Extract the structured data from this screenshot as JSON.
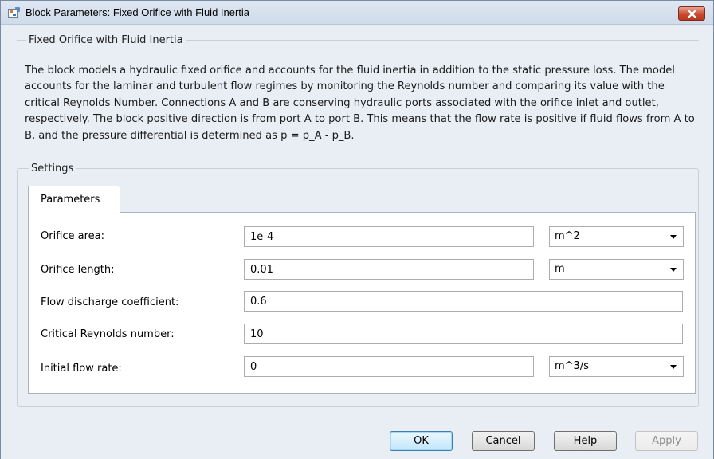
{
  "window": {
    "title": "Block Parameters: Fixed Orifice with Fluid Inertia"
  },
  "block": {
    "group_title": "Fixed Orifice with Fluid Inertia",
    "description": "The block models a hydraulic fixed orifice and accounts for the fluid inertia in addition to the static pressure loss. The model accounts for the laminar and turbulent flow regimes by monitoring the Reynolds number and comparing its value with the critical Reynolds Number. Connections A and B are conserving hydraulic ports associated with the orifice inlet and outlet, respectively. The block positive direction is from port A to port B. This means that the flow rate is positive if fluid flows from A to B, and the pressure differential is determined as p = p_A - p_B."
  },
  "settings": {
    "label": "Settings",
    "tab_label": "Parameters",
    "params": [
      {
        "label": "Orifice area:",
        "value": "1e-4",
        "unit": "m^2"
      },
      {
        "label": "Orifice length:",
        "value": "0.01",
        "unit": "m"
      },
      {
        "label": "Flow discharge coefficient:",
        "value": "0.6"
      },
      {
        "label": "Critical Reynolds number:",
        "value": "10"
      },
      {
        "label": "Initial flow rate:",
        "value": "0",
        "unit": "m^3/s"
      }
    ]
  },
  "buttons": {
    "ok": "OK",
    "cancel": "Cancel",
    "help": "Help",
    "apply": "Apply"
  },
  "icons": {
    "app": "simulink-block-icon",
    "close": "close-icon",
    "dropdown": "chevron-down-icon"
  },
  "colors": {
    "window_bg": "#e9eef4",
    "close_button": "#c94a30",
    "default_button_border": "#3c7fb1"
  }
}
